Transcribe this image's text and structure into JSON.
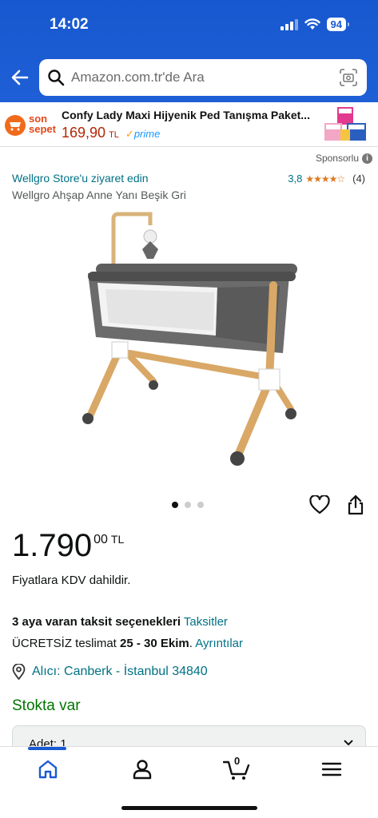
{
  "status_bar": {
    "time": "14:02",
    "battery": "94"
  },
  "search": {
    "placeholder": "Amazon.com.tr'de Ara"
  },
  "ad": {
    "brand_line1": "son",
    "brand_line2": "sepet",
    "title": "Confy Lady Maxi Hijyenik Ped Tanışma Paket...",
    "price": "169,90",
    "currency": "TL",
    "prime": "prime",
    "sponsored": "Sponsorlu"
  },
  "product": {
    "store_link": "Wellgro Store'u ziyaret edin",
    "rating_value": "3,8",
    "rating_count": "(4)",
    "rating_stars": 3.8,
    "title": "Wellgro Ahşap Anne Yanı Beşik Gri",
    "image_count": 3,
    "active_image": 1
  },
  "price": {
    "main": "1.790",
    "fraction": "00",
    "currency": "TL",
    "vat_note": "Fiyatlara KDV dahildir."
  },
  "installment": {
    "bold_text": "3 aya varan taksit seçenekleri",
    "link": "Taksitler"
  },
  "delivery": {
    "prefix": "ÜCRETSİZ teslimat",
    "dates": "25 - 30 Ekim",
    "link": "Ayrıntılar"
  },
  "location": {
    "text": "Alıcı: Canberk - İstanbul 34840"
  },
  "stock": {
    "text": "Stokta var"
  },
  "quantity": {
    "label": "Adet: 1"
  },
  "bottom_nav": {
    "cart_count": "0",
    "items": [
      "home-icon",
      "account-icon",
      "cart-icon",
      "menu-icon"
    ]
  },
  "colors": {
    "header_blue": "#1f5fd6",
    "link_teal": "#007185",
    "stock_green": "#007600",
    "price_red": "#b12704",
    "star_orange": "#de7921"
  }
}
